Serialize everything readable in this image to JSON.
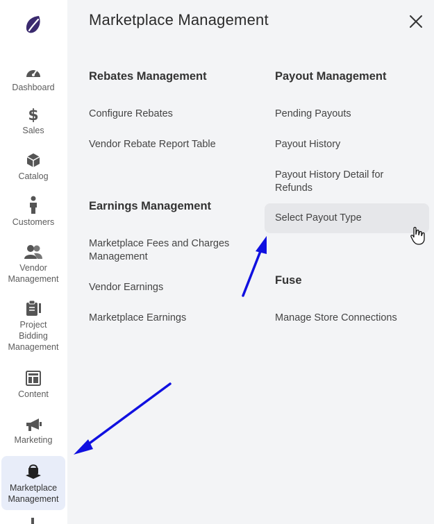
{
  "sidebar": {
    "logo_icon": "brand-logo",
    "items": [
      {
        "label": "Dashboard",
        "icon": "gauge-icon"
      },
      {
        "label": "Sales",
        "icon": "dollar-icon"
      },
      {
        "label": "Catalog",
        "icon": "box-icon"
      },
      {
        "label": "Customers",
        "icon": "person-icon"
      },
      {
        "label": "Vendor\nManagement",
        "icon": "users-icon"
      },
      {
        "label": "Project\nBidding\nManagement",
        "icon": "clipboard-icon"
      },
      {
        "label": "Content",
        "icon": "layout-icon"
      },
      {
        "label": "Marketing",
        "icon": "megaphone-icon"
      },
      {
        "label": "Marketplace\nManagement",
        "icon": "marketplace-icon",
        "active": true
      }
    ]
  },
  "panel": {
    "title": "Marketplace Management",
    "close_icon": "close-icon",
    "rebates": {
      "heading": "Rebates Management",
      "links": [
        "Configure Rebates",
        "Vendor Rebate Report Table"
      ]
    },
    "earnings": {
      "heading": "Earnings Management",
      "links": [
        "Marketplace Fees and Charges\nManagement",
        "Vendor Earnings",
        "Marketplace Earnings"
      ]
    },
    "payout": {
      "heading": "Payout Management",
      "links": [
        "Pending Payouts",
        "Payout History",
        "Payout History Detail for\nRefunds",
        "Select Payout Type"
      ],
      "hovered": "Select Payout Type"
    },
    "fuse": {
      "heading": "Fuse",
      "links": [
        "Manage Store Connections"
      ]
    }
  },
  "colors": {
    "panel_bg": "#f3f4f6",
    "active_nav_bg": "#e8edf9",
    "hover_bg": "#e6e7ea",
    "annotation_arrow": "#1010e0",
    "logo": "#3a2a6e"
  }
}
